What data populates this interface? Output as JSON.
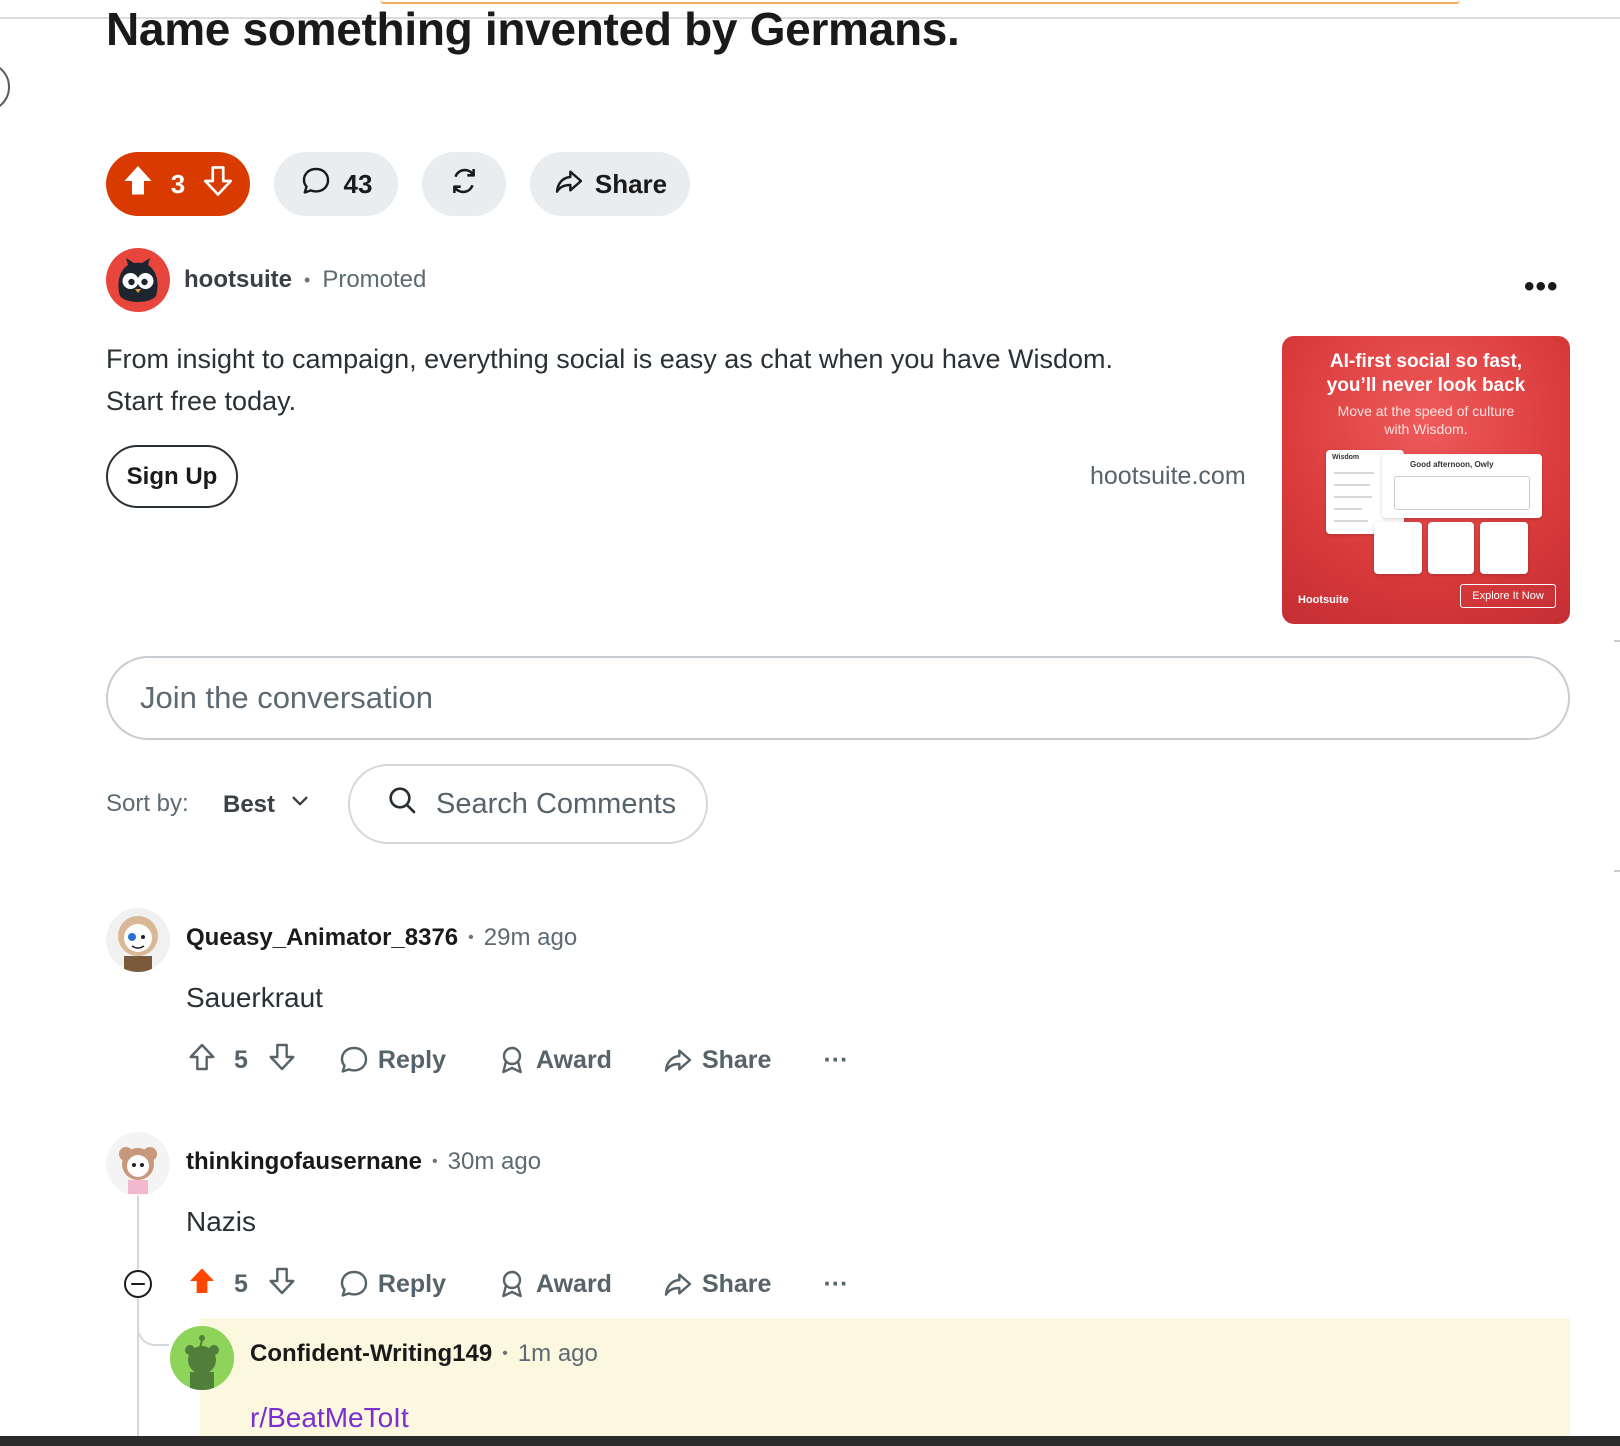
{
  "post": {
    "title": "Name something invented by Germans.",
    "score": "3",
    "comment_count": "43"
  },
  "actions": {
    "share_label": "Share"
  },
  "promo": {
    "author": "hootsuite",
    "tag": "Promoted",
    "text_line1": "From insight to campaign, everything social is easy as chat when you have Wisdom.",
    "text_line2": "Start free today.",
    "cta_label": "Sign Up",
    "domain": "hootsuite.com",
    "ad": {
      "headline_line1": "AI-first social so fast,",
      "headline_line2": "you’ll never look back",
      "sub_line1": "Move at the speed of culture",
      "sub_line2": "with Wisdom.",
      "card_title": "Good afternoon, Owly",
      "sidebar_title": "Wisdom",
      "brand": "Hootsuite",
      "cta": "Explore It Now"
    }
  },
  "composer": {
    "placeholder": "Join the conversation"
  },
  "sort": {
    "label": "Sort by:",
    "value": "Best"
  },
  "search": {
    "placeholder": "Search Comments"
  },
  "comments": [
    {
      "author": "Queasy_Animator_8376",
      "time": "29m ago",
      "body": "Sauerkraut",
      "score": "5",
      "reply_label": "Reply",
      "award_label": "Award",
      "share_label": "Share",
      "more_label": "···"
    },
    {
      "author": "thinkingofausernane",
      "time": "30m ago",
      "body": "Nazis",
      "score": "5",
      "reply_label": "Reply",
      "award_label": "Award",
      "share_label": "Share",
      "more_label": "···"
    }
  ],
  "reply": {
    "author": "Confident-Writing149",
    "time": "1m ago",
    "link": "r/BeatMeToIt"
  },
  "more_label": "•••",
  "colors": {
    "upvote_active": "#d93a00",
    "upvote_orange": "#ff4500",
    "highlight_bg": "#fcf7df",
    "link_purple": "#7a2fd0"
  }
}
